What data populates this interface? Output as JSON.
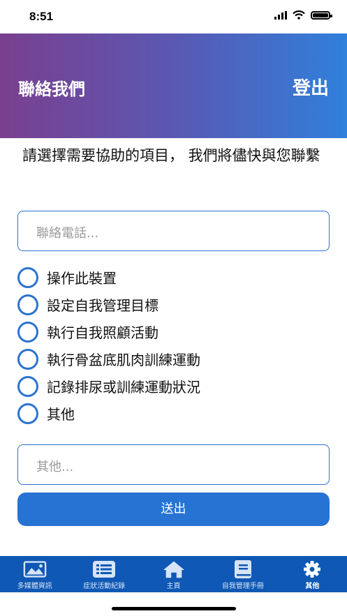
{
  "status": {
    "time": "8:51"
  },
  "header": {
    "title": "聯絡我們",
    "logout_label": "登出"
  },
  "intro_text": "請選擇需要協助的項目， 我們將儘快與您聯繫",
  "phone_input": {
    "placeholder": "聯絡電話..."
  },
  "options": [
    {
      "label": "操作此裝置"
    },
    {
      "label": "設定自我管理目標"
    },
    {
      "label": "執行自我照顧活動"
    },
    {
      "label": "執行骨盆底肌肉訓練運動"
    },
    {
      "label": "記錄排尿或訓練運動狀況"
    },
    {
      "label": "其他"
    }
  ],
  "other_input": {
    "placeholder": "其他..."
  },
  "submit_label": "送出",
  "tabs": [
    {
      "label": "多媒體資訊",
      "icon": "media-icon",
      "active": false
    },
    {
      "label": "症狀活動紀錄",
      "icon": "list-icon",
      "active": false
    },
    {
      "label": "主頁",
      "icon": "home-icon",
      "active": false
    },
    {
      "label": "自我管理手冊",
      "icon": "book-icon",
      "active": false
    },
    {
      "label": "其他",
      "icon": "gear-icon",
      "active": true
    }
  ],
  "colors": {
    "accent": "#2673d3",
    "tabbar": "#0f58b5",
    "header_start": "#7a3f8f",
    "header_end": "#2f80db"
  }
}
